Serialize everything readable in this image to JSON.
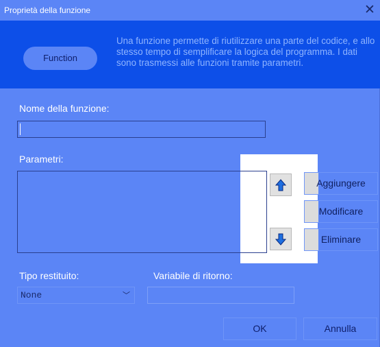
{
  "window": {
    "title": "Proprietà della funzione",
    "close_glyph": "✕"
  },
  "header": {
    "badge_label": "Function",
    "description": "Una funzione permette di riutilizzare una parte del codice, e allo stesso tempo di semplificare la logica del programma. I dati sono trasmessi alle funzioni tramite parametri."
  },
  "form": {
    "name_label": "Nome della funzione:",
    "name_value": "",
    "params_label": "Parametri:",
    "params_items": [],
    "return_type_label": "Tipo restituito:",
    "return_type_value": "None",
    "return_var_label": "Variabile di ritorno:",
    "return_var_value": ""
  },
  "param_buttons": {
    "move_up_icon": "arrow-up-icon",
    "move_down_icon": "arrow-down-icon",
    "add_label": "Aggiungere",
    "edit_label": "Modificare",
    "delete_label": "Eliminare"
  },
  "footer": {
    "ok_label": "OK",
    "cancel_label": "Annulla"
  },
  "colors": {
    "dialog_bg": "#5b85f6",
    "header_bg": "#0d4fe8",
    "arrow_fill": "#1f6fe0"
  }
}
